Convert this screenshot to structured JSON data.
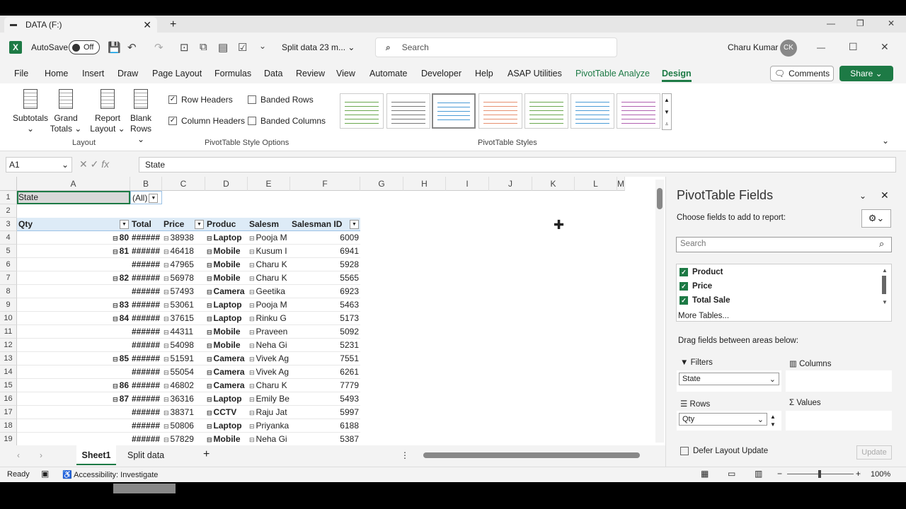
{
  "browser": {
    "tab_title": "DATA (F:)",
    "tab_close": "✕",
    "new_tab": "+"
  },
  "app": {
    "autosave_label": "AutoSave",
    "autosave_state": "Off",
    "filename": "Split data 23 m...",
    "search_placeholder": "Search",
    "user_name": "Charu Kumar",
    "user_initials": "CK"
  },
  "menu": [
    "File",
    "Home",
    "Insert",
    "Draw",
    "Page Layout",
    "Formulas",
    "Data",
    "Review",
    "View",
    "Automate",
    "Developer",
    "Help",
    "ASAP Utilities",
    "PivotTable Analyze",
    "Design"
  ],
  "buttons": {
    "comments": "Comments",
    "share": "Share"
  },
  "ribbon": {
    "layout_buttons": [
      {
        "l1": "Subtotals",
        "l2": "⌄"
      },
      {
        "l1": "Grand",
        "l2": "Totals ⌄"
      },
      {
        "l1": "Report",
        "l2": "Layout ⌄"
      },
      {
        "l1": "Blank",
        "l2": "Rows ⌄"
      }
    ],
    "layout_group": "Layout",
    "options": {
      "row_headers": "Row Headers",
      "column_headers": "Column Headers",
      "banded_rows": "Banded Rows",
      "banded_columns": "Banded Columns"
    },
    "options_group": "PivotTable Style Options",
    "styles_group": "PivotTable Styles",
    "style_colors": [
      "#6aa84f",
      "#777777",
      "#4a9bd6",
      "#e69070",
      "#6aa84f",
      "#4a9bd6",
      "#b060b0"
    ]
  },
  "formula": {
    "namebox": "A1",
    "fx": "fx",
    "content": "State"
  },
  "columns": [
    "A",
    "B",
    "C",
    "D",
    "E",
    "F",
    "G",
    "H",
    "I",
    "J",
    "K",
    "L",
    "M"
  ],
  "pivot": {
    "filter_label": "State",
    "filter_value": "(All)",
    "headers": [
      "Qty",
      "Total",
      "Price",
      "Produc",
      "Salesm",
      "Salesman ID"
    ],
    "rows": [
      {
        "qty": "80",
        "total": "######",
        "price": "38938",
        "product": "Laptop",
        "salesman": "Pooja M",
        "id": "6009"
      },
      {
        "qty": "81",
        "total": "######",
        "price": "46418",
        "product": "Mobile",
        "salesman": "Kusum I",
        "id": "6941"
      },
      {
        "qty": "",
        "total": "######",
        "price": "47965",
        "product": "Mobile",
        "salesman": "Charu K",
        "id": "5928"
      },
      {
        "qty": "82",
        "total": "######",
        "price": "56978",
        "product": "Mobile",
        "salesman": "Charu K",
        "id": "5565"
      },
      {
        "qty": "",
        "total": "######",
        "price": "57493",
        "product": "Camera",
        "salesman": "Geetika",
        "id": "6923"
      },
      {
        "qty": "83",
        "total": "######",
        "price": "53061",
        "product": "Laptop",
        "salesman": "Pooja M",
        "id": "5463"
      },
      {
        "qty": "84",
        "total": "######",
        "price": "37615",
        "product": "Laptop",
        "salesman": "Rinku G",
        "id": "5173"
      },
      {
        "qty": "",
        "total": "######",
        "price": "44311",
        "product": "Mobile",
        "salesman": "Praveen",
        "id": "5092"
      },
      {
        "qty": "",
        "total": "######",
        "price": "54098",
        "product": "Mobile",
        "salesman": "Neha Gi",
        "id": "5231"
      },
      {
        "qty": "85",
        "total": "######",
        "price": "51591",
        "product": "Camera",
        "salesman": "Vivek Ag",
        "id": "7551"
      },
      {
        "qty": "",
        "total": "######",
        "price": "55054",
        "product": "Camera",
        "salesman": "Vivek Ag",
        "id": "6261"
      },
      {
        "qty": "86",
        "total": "######",
        "price": "46802",
        "product": "Camera",
        "salesman": "Charu K",
        "id": "7779"
      },
      {
        "qty": "87",
        "total": "######",
        "price": "36316",
        "product": "Laptop",
        "salesman": "Emily Be",
        "id": "5493"
      },
      {
        "qty": "",
        "total": "######",
        "price": "38371",
        "product": "CCTV",
        "salesman": "Raju Jat",
        "id": "5997"
      },
      {
        "qty": "",
        "total": "######",
        "price": "50806",
        "product": "Laptop",
        "salesman": "Priyanka",
        "id": "6188"
      },
      {
        "qty": "",
        "total": "######",
        "price": "57829",
        "product": "Mobile",
        "salesman": "Neha Gi",
        "id": "5387"
      }
    ]
  },
  "sheets": {
    "active": "Sheet1",
    "other": "Split data",
    "add": "+"
  },
  "status": {
    "ready": "Ready",
    "accessibility": "Accessibility: Investigate",
    "zoom": "100%"
  },
  "pane": {
    "title": "PivotTable Fields",
    "subtitle": "Choose fields to add to report:",
    "search_placeholder": "Search",
    "fields": [
      "Product",
      "Price",
      "Total Sale"
    ],
    "more_tables": "More Tables...",
    "drag_hint": "Drag fields between areas below:",
    "filters_label": "Filters",
    "columns_label": "Columns",
    "rows_label": "Rows",
    "values_label": "Values",
    "filter_item": "State",
    "row_item": "Qty",
    "defer": "Defer Layout Update",
    "update": "Update"
  }
}
